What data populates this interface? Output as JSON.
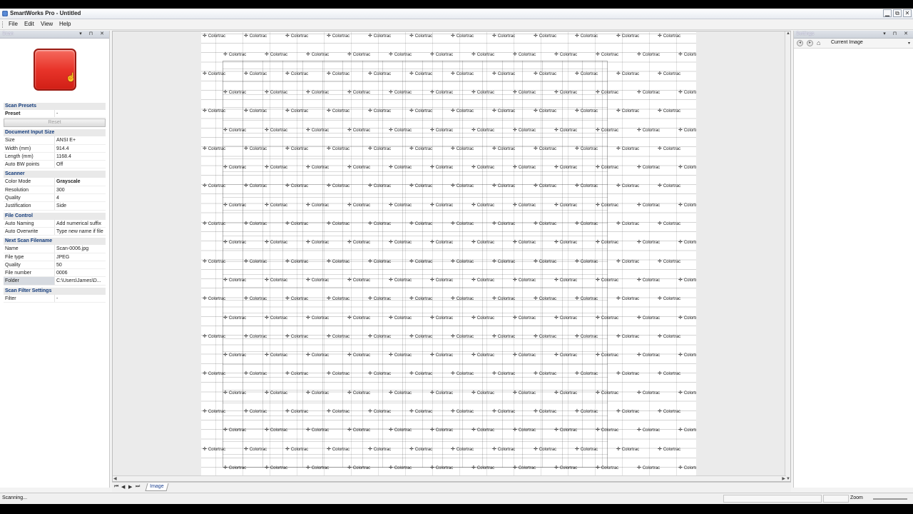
{
  "window": {
    "title": "SmartWorks Pro - Untitled",
    "buttons": [
      "▁",
      "⧉",
      "✕"
    ]
  },
  "menu": [
    "File",
    "Edit",
    "View",
    "Help"
  ],
  "scan_panel": {
    "title": "Scan",
    "sections": {
      "presets": {
        "title": "Scan Presets",
        "preset_label": "Preset",
        "preset_value": "-",
        "reset_label": "Reset"
      },
      "doc_size": {
        "title": "Document Input Size",
        "rows": [
          {
            "k": "Size",
            "v": "ANSI E+"
          },
          {
            "k": "Width (mm)",
            "v": "914.4"
          },
          {
            "k": "Length (mm)",
            "v": "1168.4"
          },
          {
            "k": "Auto BW points",
            "v": "Off"
          }
        ]
      },
      "scanner": {
        "title": "Scanner",
        "rows": [
          {
            "k": "Color Mode",
            "v": "Grayscale"
          },
          {
            "k": "Resolution",
            "v": "300"
          },
          {
            "k": "Quality",
            "v": "4"
          },
          {
            "k": "Justification",
            "v": "Side"
          }
        ]
      },
      "file_control": {
        "title": "File Control",
        "rows": [
          {
            "k": "Auto Naming",
            "v": "Add numerical suffix"
          },
          {
            "k": "Auto Overwrite",
            "v": "Type new name if file"
          }
        ]
      },
      "next_scan": {
        "title": "Next Scan Filename",
        "rows": [
          {
            "k": "Name",
            "v": "Scan-0006.jpg"
          },
          {
            "k": "File type",
            "v": "JPEG"
          },
          {
            "k": "Quality",
            "v": "50"
          },
          {
            "k": "File number",
            "v": "0006"
          },
          {
            "k": "Folder",
            "v": "C:\\Users\\James\\D..."
          }
        ]
      },
      "filter": {
        "title": "Scan Filter Settings",
        "rows": [
          {
            "k": "Filter",
            "v": "-"
          }
        ]
      }
    }
  },
  "image_view": {
    "watermark_text": "Colortrac",
    "tab_label": "Image",
    "nav_buttons": [
      "⏮",
      "◀",
      "▶",
      "⏭"
    ]
  },
  "settings_panel": {
    "title": "Settings",
    "current_image_label": "Current Image"
  },
  "status": {
    "text": "Scanning...",
    "zoom_label": "Zoom"
  },
  "colors": {
    "scan_button": "#e8342a",
    "section_title": "#123a7a"
  }
}
